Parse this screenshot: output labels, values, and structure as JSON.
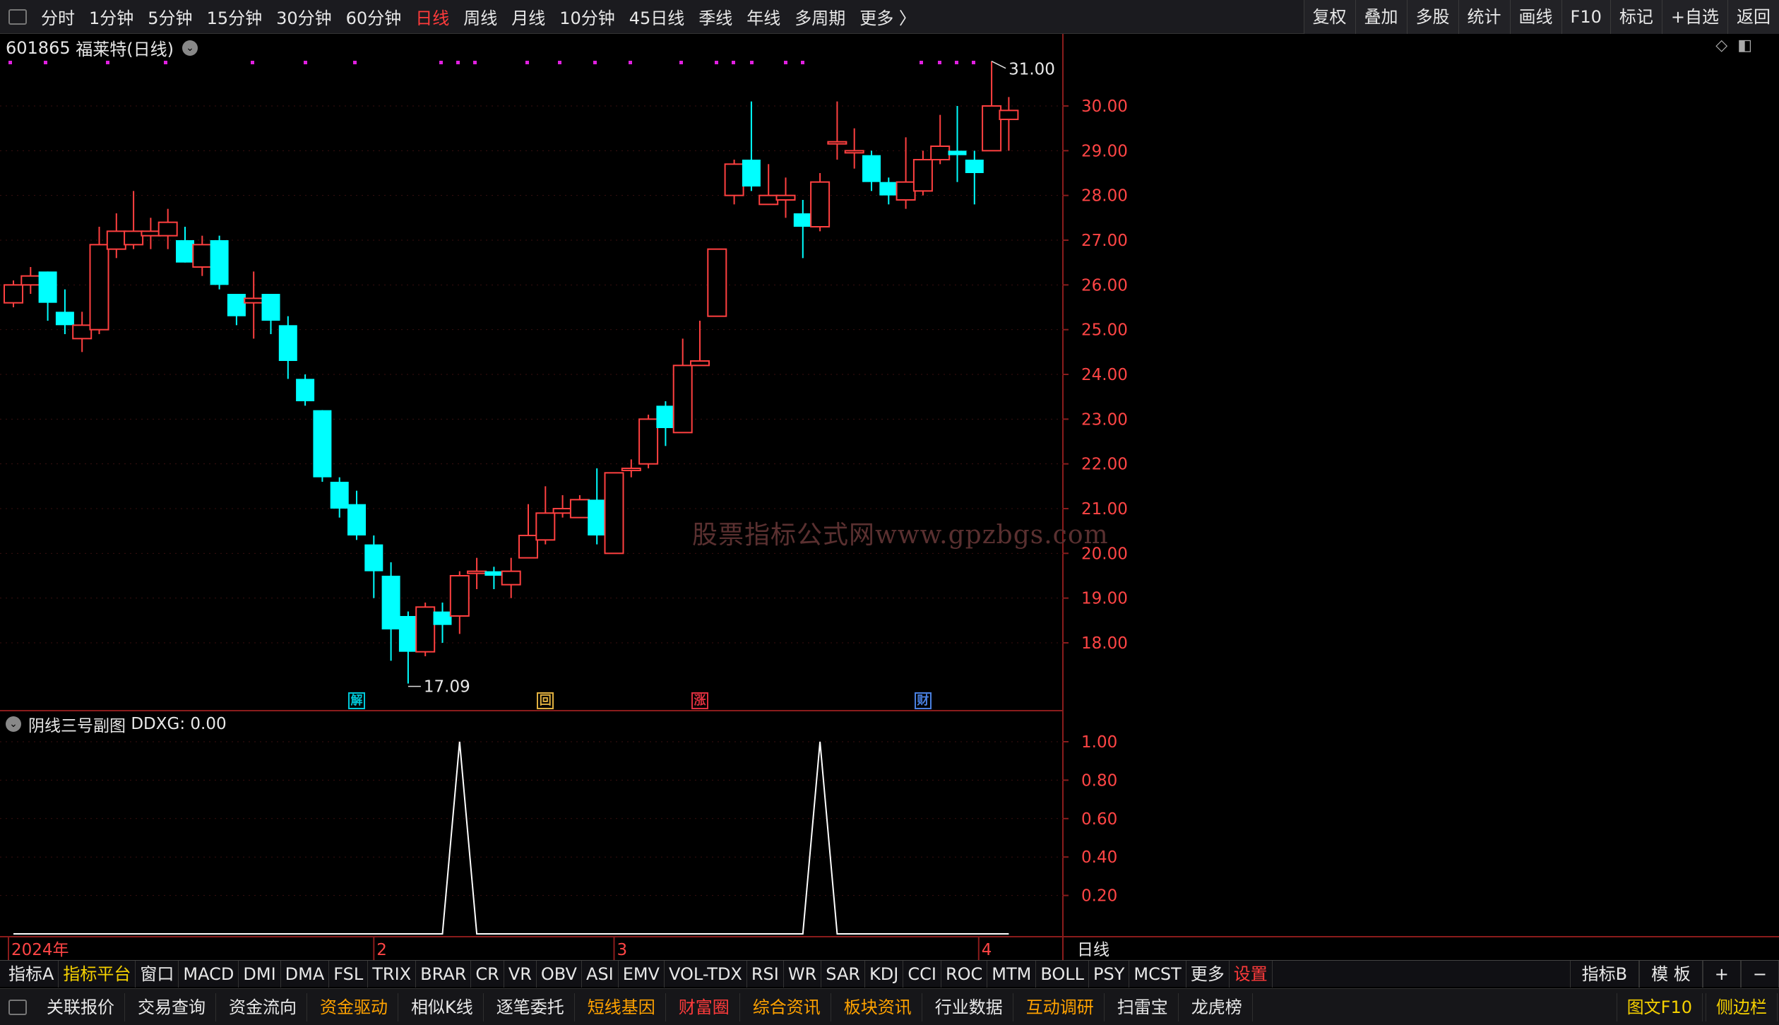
{
  "toolbar": {
    "periods": [
      "分时",
      "1分钟",
      "5分钟",
      "15分钟",
      "30分钟",
      "60分钟",
      "日线",
      "周线",
      "月线",
      "10分钟",
      "45日线",
      "季线",
      "年线",
      "多周期",
      "更多 〉"
    ],
    "active_period": "日线",
    "right_buttons": [
      "复权",
      "叠加",
      "多股",
      "统计",
      "画线",
      "F10",
      "标记",
      "+自选",
      "返回"
    ]
  },
  "stock": {
    "code": "601865",
    "name": "福莱特",
    "period": "(日线)"
  },
  "main_chart": {
    "price_labels": [
      "30.00",
      "29.00",
      "28.00",
      "27.00",
      "26.00",
      "25.00",
      "24.00",
      "23.00",
      "22.00",
      "21.00",
      "20.00",
      "19.00",
      "18.00"
    ],
    "high_annotation": "31.00",
    "low_annotation": "17.09",
    "event_markers": [
      {
        "label": "解",
        "color": "#00c8d8"
      },
      {
        "label": "回",
        "color": "#e0b040"
      },
      {
        "label": "涨",
        "color": "#e03040"
      },
      {
        "label": "财",
        "color": "#4a80e0"
      }
    ],
    "watermark": "股票指标公式网www.gpzbgs.com"
  },
  "sub_chart": {
    "title": "阴线三号副图",
    "value_label": "DDXG: 0.00",
    "y_labels": [
      "1.00",
      "0.80",
      "0.60",
      "0.40",
      "0.20"
    ]
  },
  "time_axis": {
    "labels": [
      "2024年",
      "2",
      "3",
      "4"
    ],
    "period_label": "日线"
  },
  "indicator_bar": {
    "items": [
      "指标A",
      "指标平台",
      "窗口",
      "MACD",
      "DMI",
      "DMA",
      "FSL",
      "TRIX",
      "BRAR",
      "CR",
      "VR",
      "OBV",
      "ASI",
      "EMV",
      "VOL-TDX",
      "RSI",
      "WR",
      "SAR",
      "KDJ",
      "CCI",
      "ROC",
      "MTM",
      "BOLL",
      "PSY",
      "MCST",
      "更多",
      "设置"
    ],
    "right": [
      "指标B",
      "模 板",
      "+",
      "−"
    ]
  },
  "function_bar": {
    "items": [
      {
        "label": "关联报价",
        "color": "#e8e8e8"
      },
      {
        "label": "交易查询",
        "color": "#e8e8e8"
      },
      {
        "label": "资金流向",
        "color": "#e8e8e8"
      },
      {
        "label": "资金驱动",
        "color": "#ffa200"
      },
      {
        "label": "相似K线",
        "color": "#e8e8e8"
      },
      {
        "label": "逐笔委托",
        "color": "#e8e8e8"
      },
      {
        "label": "短线基因",
        "color": "#ffa200"
      },
      {
        "label": "财富圈",
        "color": "#ff3b3b"
      },
      {
        "label": "综合资讯",
        "color": "#ffa200"
      },
      {
        "label": "板块资讯",
        "color": "#ffa200"
      },
      {
        "label": "行业数据",
        "color": "#e8e8e8"
      },
      {
        "label": "互动调研",
        "color": "#ffa200"
      },
      {
        "label": "扫雷宝",
        "color": "#e8e8e8"
      },
      {
        "label": "龙虎榜",
        "color": "#e8e8e8"
      }
    ],
    "right": [
      "图文F10",
      "侧边栏"
    ]
  },
  "chart_data": {
    "type": "candlestick",
    "up_color": "#ff4040",
    "down_color": "#00ffff",
    "y_range": [
      16.5,
      31.5
    ],
    "candles": [
      {
        "o": 25.6,
        "h": 26.1,
        "l": 25.5,
        "c": 26.0
      },
      {
        "o": 26.0,
        "h": 26.4,
        "l": 25.8,
        "c": 26.2
      },
      {
        "o": 26.3,
        "h": 26.3,
        "l": 25.2,
        "c": 25.6
      },
      {
        "o": 25.4,
        "h": 25.9,
        "l": 24.9,
        "c": 25.1
      },
      {
        "o": 24.8,
        "h": 25.4,
        "l": 24.5,
        "c": 25.1
      },
      {
        "o": 25.0,
        "h": 27.3,
        "l": 24.9,
        "c": 26.9
      },
      {
        "o": 26.8,
        "h": 27.6,
        "l": 26.6,
        "c": 27.2
      },
      {
        "o": 26.9,
        "h": 28.1,
        "l": 26.8,
        "c": 27.2
      },
      {
        "o": 27.1,
        "h": 27.5,
        "l": 26.8,
        "c": 27.2
      },
      {
        "o": 27.1,
        "h": 27.7,
        "l": 26.8,
        "c": 27.4
      },
      {
        "o": 27.0,
        "h": 27.3,
        "l": 26.5,
        "c": 26.5
      },
      {
        "o": 26.4,
        "h": 27.1,
        "l": 26.2,
        "c": 26.9
      },
      {
        "o": 27.0,
        "h": 27.1,
        "l": 25.9,
        "c": 26.0
      },
      {
        "o": 25.8,
        "h": 25.8,
        "l": 25.1,
        "c": 25.3
      },
      {
        "o": 25.6,
        "h": 26.3,
        "l": 24.8,
        "c": 25.7
      },
      {
        "o": 25.8,
        "h": 25.8,
        "l": 24.9,
        "c": 25.2
      },
      {
        "o": 25.1,
        "h": 25.3,
        "l": 23.9,
        "c": 24.3
      },
      {
        "o": 23.9,
        "h": 24.0,
        "l": 23.3,
        "c": 23.4
      },
      {
        "o": 23.2,
        "h": 23.2,
        "l": 21.6,
        "c": 21.7
      },
      {
        "o": 21.6,
        "h": 21.7,
        "l": 20.8,
        "c": 21.0
      },
      {
        "o": 21.1,
        "h": 21.4,
        "l": 20.3,
        "c": 20.4
      },
      {
        "o": 20.2,
        "h": 20.4,
        "l": 19.0,
        "c": 19.6
      },
      {
        "o": 19.5,
        "h": 19.8,
        "l": 17.6,
        "c": 18.3
      },
      {
        "o": 18.6,
        "h": 18.7,
        "l": 17.09,
        "c": 17.8
      },
      {
        "o": 17.8,
        "h": 18.9,
        "l": 17.7,
        "c": 18.8
      },
      {
        "o": 18.7,
        "h": 18.9,
        "l": 18.0,
        "c": 18.4
      },
      {
        "o": 18.6,
        "h": 19.6,
        "l": 18.2,
        "c": 19.5
      },
      {
        "o": 19.6,
        "h": 19.9,
        "l": 19.2,
        "c": 19.6
      },
      {
        "o": 19.6,
        "h": 19.7,
        "l": 19.2,
        "c": 19.5
      },
      {
        "o": 19.3,
        "h": 19.9,
        "l": 19.0,
        "c": 19.6
      },
      {
        "o": 19.9,
        "h": 21.1,
        "l": 19.9,
        "c": 20.4
      },
      {
        "o": 20.3,
        "h": 21.5,
        "l": 20.2,
        "c": 20.9
      },
      {
        "o": 20.9,
        "h": 21.3,
        "l": 20.8,
        "c": 21.0
      },
      {
        "o": 20.8,
        "h": 21.3,
        "l": 20.8,
        "c": 21.2
      },
      {
        "o": 21.2,
        "h": 21.9,
        "l": 20.2,
        "c": 20.4
      },
      {
        "o": 20.0,
        "h": 21.8,
        "l": 20.0,
        "c": 21.8
      },
      {
        "o": 21.9,
        "h": 22.1,
        "l": 21.7,
        "c": 21.9
      },
      {
        "o": 22.0,
        "h": 23.1,
        "l": 21.9,
        "c": 23.0
      },
      {
        "o": 23.3,
        "h": 23.4,
        "l": 22.4,
        "c": 22.8
      },
      {
        "o": 22.7,
        "h": 24.8,
        "l": 22.7,
        "c": 24.2
      },
      {
        "o": 24.2,
        "h": 25.2,
        "l": 24.2,
        "c": 24.3
      },
      {
        "o": 25.3,
        "h": 26.8,
        "l": 25.3,
        "c": 26.8
      },
      {
        "o": 28.0,
        "h": 28.8,
        "l": 27.8,
        "c": 28.7
      },
      {
        "o": 28.8,
        "h": 30.1,
        "l": 28.1,
        "c": 28.2
      },
      {
        "o": 27.8,
        "h": 28.7,
        "l": 27.8,
        "c": 28.0
      },
      {
        "o": 27.9,
        "h": 28.4,
        "l": 27.5,
        "c": 28.0
      },
      {
        "o": 27.6,
        "h": 27.9,
        "l": 26.6,
        "c": 27.3
      },
      {
        "o": 27.3,
        "h": 28.5,
        "l": 27.2,
        "c": 28.3
      },
      {
        "o": 29.2,
        "h": 30.1,
        "l": 28.8,
        "c": 29.2
      },
      {
        "o": 29.0,
        "h": 29.5,
        "l": 28.6,
        "c": 29.0
      },
      {
        "o": 28.9,
        "h": 29.0,
        "l": 28.1,
        "c": 28.3
      },
      {
        "o": 28.3,
        "h": 28.4,
        "l": 27.8,
        "c": 28.0
      },
      {
        "o": 27.9,
        "h": 29.3,
        "l": 27.7,
        "c": 28.3
      },
      {
        "o": 28.1,
        "h": 29.0,
        "l": 28.0,
        "c": 28.8
      },
      {
        "o": 28.8,
        "h": 29.8,
        "l": 28.7,
        "c": 29.1
      },
      {
        "o": 29.0,
        "h": 30.0,
        "l": 28.3,
        "c": 28.9
      },
      {
        "o": 28.8,
        "h": 29.0,
        "l": 27.8,
        "c": 28.5
      },
      {
        "o": 29.0,
        "h": 31.0,
        "l": 29.0,
        "c": 30.0
      },
      {
        "o": 29.7,
        "h": 30.2,
        "l": 29.0,
        "c": 29.9
      }
    ],
    "sub_indicator": {
      "name": "DDXG",
      "y_range": [
        0,
        1.0
      ],
      "values": [
        0,
        0,
        0,
        0,
        0,
        0,
        0,
        0,
        0,
        0,
        0,
        0,
        0,
        0,
        0,
        0,
        0,
        0,
        0,
        0,
        0,
        0,
        0,
        0,
        0,
        0,
        1,
        0,
        0,
        0,
        0,
        0,
        0,
        0,
        0,
        0,
        0,
        0,
        0,
        0,
        0,
        0,
        0,
        0,
        0,
        0,
        0,
        1,
        0,
        0,
        0,
        0,
        0,
        0,
        0,
        0,
        0,
        0,
        0
      ]
    }
  }
}
